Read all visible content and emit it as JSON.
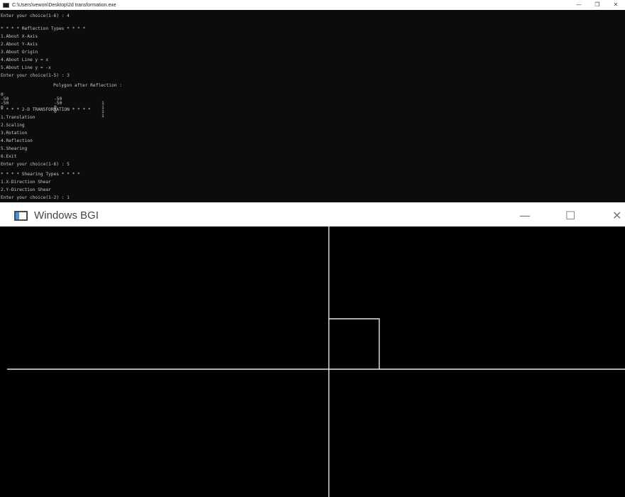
{
  "console": {
    "title": "C:\\Users\\vewon\\Desktop\\2d transformation.exe",
    "controls": {
      "minimize": "—",
      "maximize": "❐",
      "close": "✕"
    },
    "lines": [
      "Enter your choice(1-6) : 4",
      "* * * * Reflection Types * * * *",
      "1.About X-Axis",
      "2.About Y-Axis",
      "3.About Origin",
      "4.About Line y = x",
      "5.About Line y = -x",
      "Enter your choice(1-5) : 3",
      "* * * * 2-D TRANSFORMATION * * * *",
      "1.Translation",
      "2.Scaling",
      "3.Rotation",
      "4.Reflection",
      "5.Shearing",
      "6.Exit",
      "Enter your choice(1-6) : 5",
      "* * * * Shearing Types * * * *",
      "1.X-Direction Shear",
      "2.Y-Direction Shear",
      "Enter your choice(1-2) : 1"
    ],
    "table": {
      "header": "Polygon after Reflection :",
      "rows": [
        [
          "0",
          "-50",
          "1"
        ],
        [
          "-50",
          "-50",
          "1"
        ],
        [
          "-50",
          "0",
          "1"
        ],
        [
          "0",
          "0",
          "1"
        ]
      ]
    }
  },
  "bgi": {
    "title": "Windows BGI",
    "controls": {
      "minimize": "—",
      "maximize": "☐",
      "close": "✕"
    },
    "line_color": "#e6e6e6",
    "square": {
      "side": 50
    }
  }
}
